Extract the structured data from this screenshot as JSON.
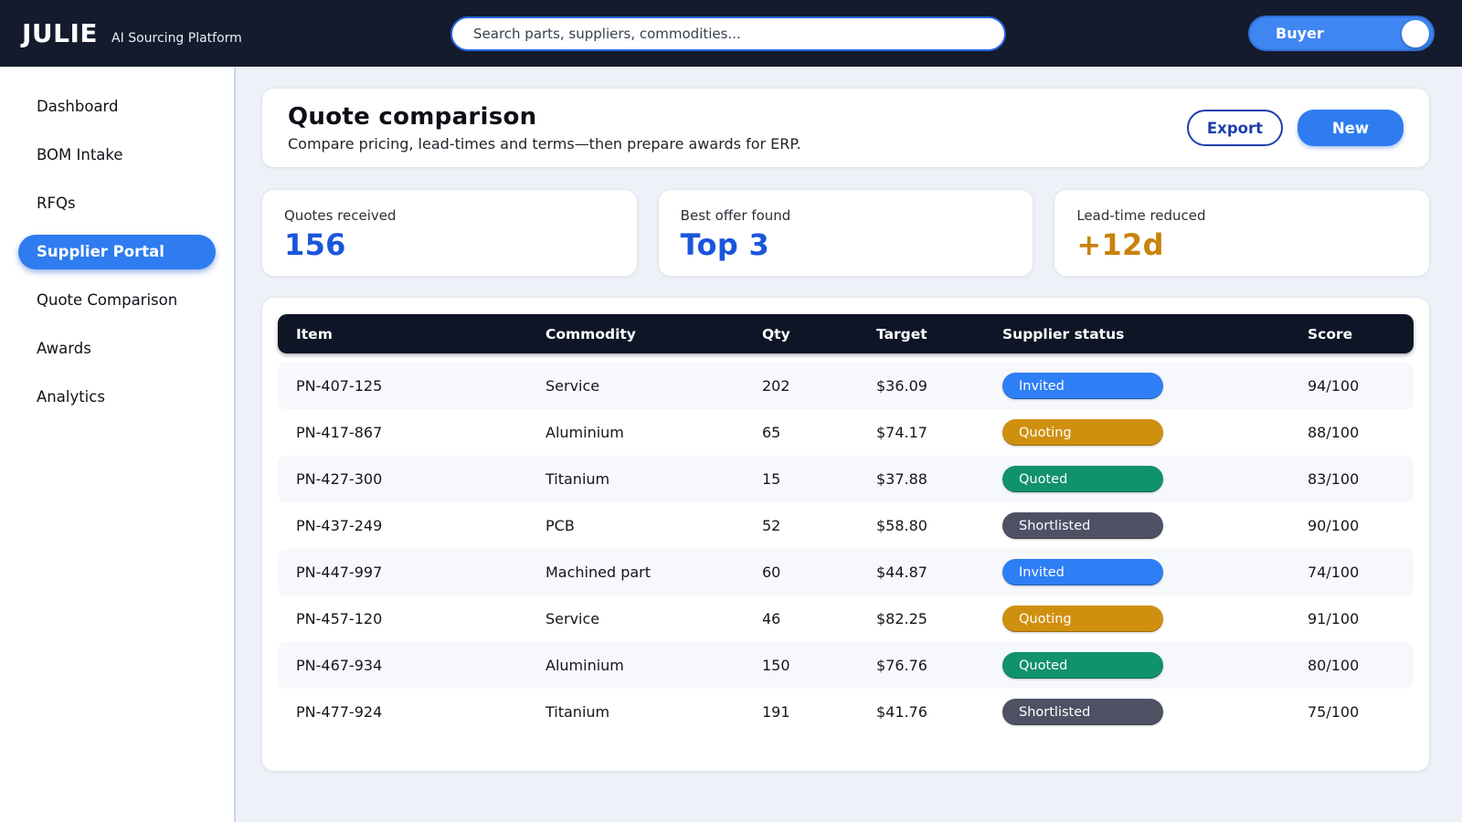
{
  "topbar": {
    "brand": "JULIE",
    "brand_sub": "AI Sourcing Platform",
    "search_placeholder": "Search parts, suppliers, commodities...",
    "role_toggle_label": "Buyer"
  },
  "sidebar": {
    "items": [
      {
        "label": "Dashboard",
        "active": false
      },
      {
        "label": "BOM Intake",
        "active": false
      },
      {
        "label": "RFQs",
        "active": false
      },
      {
        "label": "Supplier Portal",
        "active": true
      },
      {
        "label": "Quote Comparison",
        "active": false
      },
      {
        "label": "Awards",
        "active": false
      },
      {
        "label": "Analytics",
        "active": false
      }
    ]
  },
  "header": {
    "title": "Quote comparison",
    "subtitle": "Compare pricing, lead-times and terms—then prepare awards for ERP.",
    "export_label": "Export",
    "new_label": "New"
  },
  "stats": [
    {
      "label": "Quotes received",
      "value": "156",
      "color": "#1a56db"
    },
    {
      "label": "Best offer found",
      "value": "Top 3",
      "color": "#1a56db"
    },
    {
      "label": "Lead-time reduced",
      "value": "+12d",
      "color": "#c8830b"
    }
  ],
  "table": {
    "columns": [
      "Item",
      "Commodity",
      "Qty",
      "Target",
      "Supplier status",
      "Score"
    ],
    "status_colors": {
      "Invited": "#2e7ef5",
      "Quoting": "#d0900f",
      "Quoted": "#10926b",
      "Shortlisted": "#4e5064"
    },
    "rows": [
      {
        "item": "PN-407-125",
        "commodity": "Service",
        "qty": "202",
        "target": "$36.09",
        "status": "Invited",
        "score": "94/100"
      },
      {
        "item": "PN-417-867",
        "commodity": "Aluminium",
        "qty": "65",
        "target": "$74.17",
        "status": "Quoting",
        "score": "88/100"
      },
      {
        "item": "PN-427-300",
        "commodity": "Titanium",
        "qty": "15",
        "target": "$37.88",
        "status": "Quoted",
        "score": "83/100"
      },
      {
        "item": "PN-437-249",
        "commodity": "PCB",
        "qty": "52",
        "target": "$58.80",
        "status": "Shortlisted",
        "score": "90/100"
      },
      {
        "item": "PN-447-997",
        "commodity": "Machined part",
        "qty": "60",
        "target": "$44.87",
        "status": "Invited",
        "score": "74/100"
      },
      {
        "item": "PN-457-120",
        "commodity": "Service",
        "qty": "46",
        "target": "$82.25",
        "status": "Quoting",
        "score": "91/100"
      },
      {
        "item": "PN-467-934",
        "commodity": "Aluminium",
        "qty": "150",
        "target": "$76.76",
        "status": "Quoted",
        "score": "80/100"
      },
      {
        "item": "PN-477-924",
        "commodity": "Titanium",
        "qty": "191",
        "target": "$41.76",
        "status": "Shortlisted",
        "score": "75/100"
      }
    ]
  }
}
